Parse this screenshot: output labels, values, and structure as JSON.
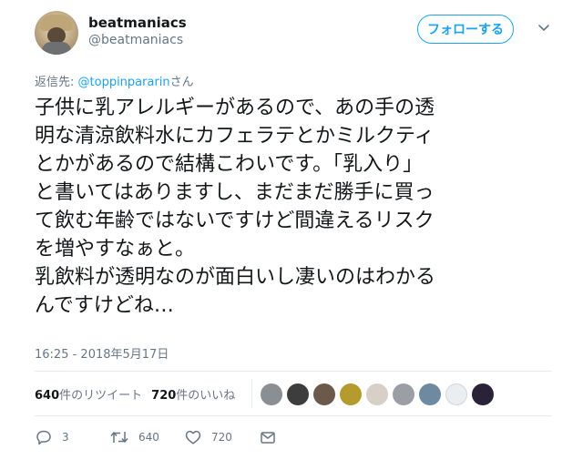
{
  "user": {
    "name": "beatmaniacs",
    "handle": "@beatmaniacs"
  },
  "follow_label": "フォローする",
  "reply": {
    "prefix": "返信先: ",
    "mention": "@toppinpararin",
    "suffix": "さん"
  },
  "tweet": {
    "text": "子供に乳アレルギーがあるので、あの手の透\n明な清涼飲料水にカフェラテとかミルクティ\nとかがあるので結構こわいです。「乳入り」\nと書いてはありますし、まだまだ勝手に買っ\nて飲む年齢ではないですけど間違えるリスク\nを増やすなぁと。\n乳飲料が透明なのが面白いし凄いのはわかる\nんですけどね…"
  },
  "timestamp": "16:25 - 2018年5月17日",
  "stats": {
    "retweets_count": "640",
    "retweets_label": "件のリツイート",
    "likes_count": "720",
    "likes_label": "件のいいね"
  },
  "likers": [
    {
      "color": "#8a8f94"
    },
    {
      "color": "#3d3d3d"
    },
    {
      "color": "#6b5a4a"
    },
    {
      "color": "#b59a2e"
    },
    {
      "color": "#d8d0c6"
    },
    {
      "color": "#9a9fa5"
    },
    {
      "color": "#6e8aa0"
    },
    {
      "color": "#e9eef2"
    },
    {
      "color": "#2a2236"
    }
  ],
  "actions": {
    "reply_count": "3",
    "retweet_count": "640",
    "like_count": "720"
  },
  "colors": {
    "accent": "#1da1f2",
    "muted": "#657786",
    "text": "#14171a",
    "divider": "#e6ecf0"
  }
}
